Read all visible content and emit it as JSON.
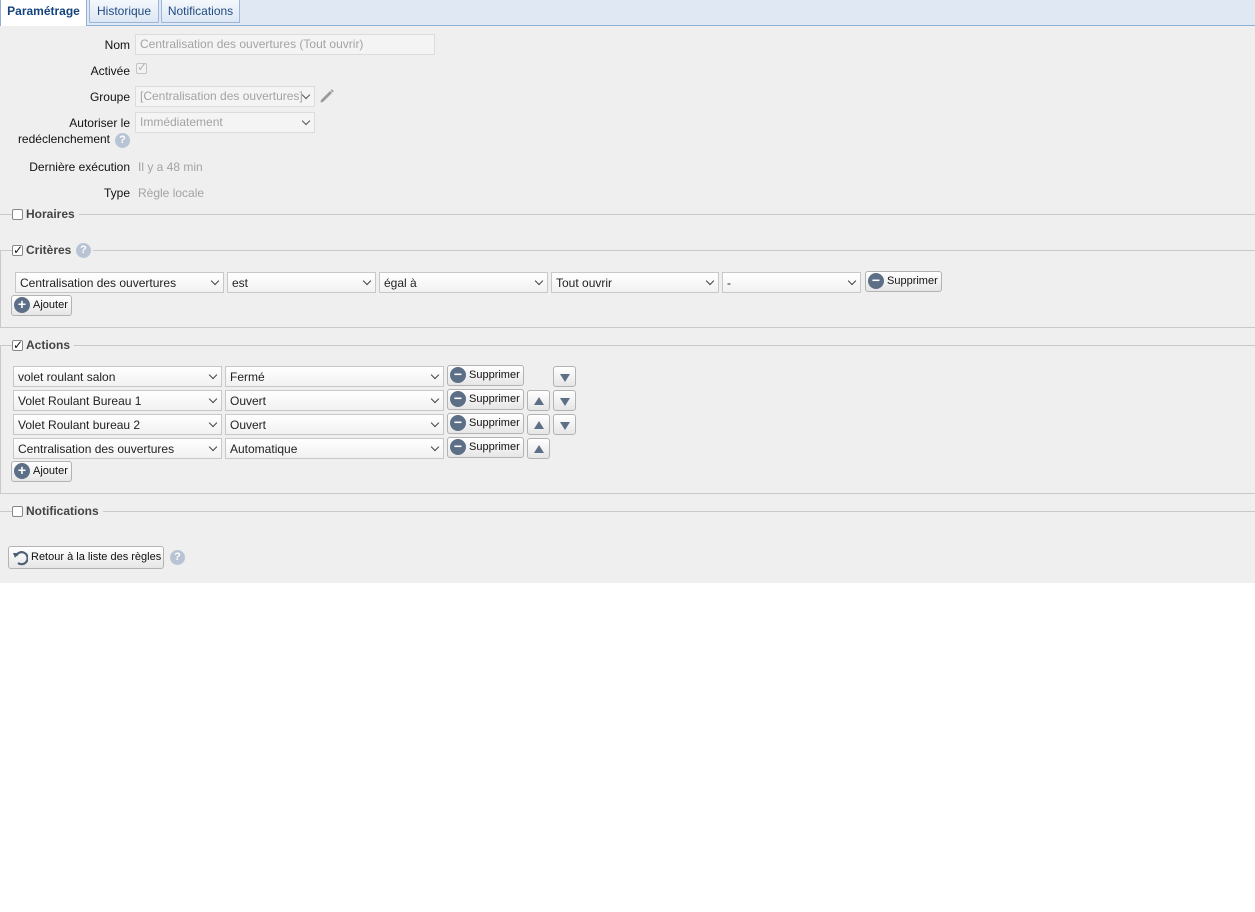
{
  "tabs": [
    {
      "label": "Paramétrage"
    },
    {
      "label": "Historique"
    },
    {
      "label": "Notifications"
    }
  ],
  "form": {
    "name_label": "Nom",
    "name_value": "Centralisation des ouvertures (Tout ouvrir)",
    "active_label": "Activée",
    "active_checked": true,
    "group_label": "Groupe",
    "group_value": "[Centralisation des ouvertures]",
    "retrigger_label_1": "Autoriser le",
    "retrigger_label_2": "redéclenchement",
    "retrigger_value": "Immédiatement",
    "last_exec_label": "Dernière exécution",
    "last_exec_value": "Il y a 48 min",
    "type_label": "Type",
    "type_value": "Règle locale"
  },
  "sections": {
    "schedules": {
      "label": "Horaires",
      "checked": false
    },
    "criteria": {
      "label": "Critères",
      "checked": true
    },
    "actions": {
      "label": "Actions",
      "checked": true
    },
    "notifications": {
      "label": "Notifications",
      "checked": false
    }
  },
  "criteria": [
    {
      "device": "Centralisation des ouvertures",
      "condition": "est",
      "operator": "égal à",
      "value": "Tout ouvrir",
      "extra": "-",
      "delete_label": "Supprimer"
    }
  ],
  "criteria_add_label": "Ajouter",
  "actions": [
    {
      "device": "volet roulant salon",
      "state": "Fermé",
      "delete_label": "Supprimer",
      "up": false,
      "down": true
    },
    {
      "device": "Volet Roulant Bureau 1",
      "state": "Ouvert",
      "delete_label": "Supprimer",
      "up": true,
      "down": true
    },
    {
      "device": "Volet Roulant bureau 2",
      "state": "Ouvert",
      "delete_label": "Supprimer",
      "up": true,
      "down": true
    },
    {
      "device": "Centralisation des ouvertures",
      "state": "Automatique",
      "delete_label": "Supprimer",
      "up": true,
      "down": false
    }
  ],
  "actions_add_label": "Ajouter",
  "back_button_label": "Retour à la liste des règles",
  "colors": {
    "tab_text": "#1f4a82",
    "panel_bg": "#efefef",
    "icon_bg": "#5d6f87",
    "help_bg": "#b8c4d3"
  },
  "icons": {
    "edit": "pencil-icon",
    "help": "question-icon",
    "add": "plus-circle-icon",
    "remove": "minus-circle-icon",
    "back": "undo-arrow-icon"
  }
}
